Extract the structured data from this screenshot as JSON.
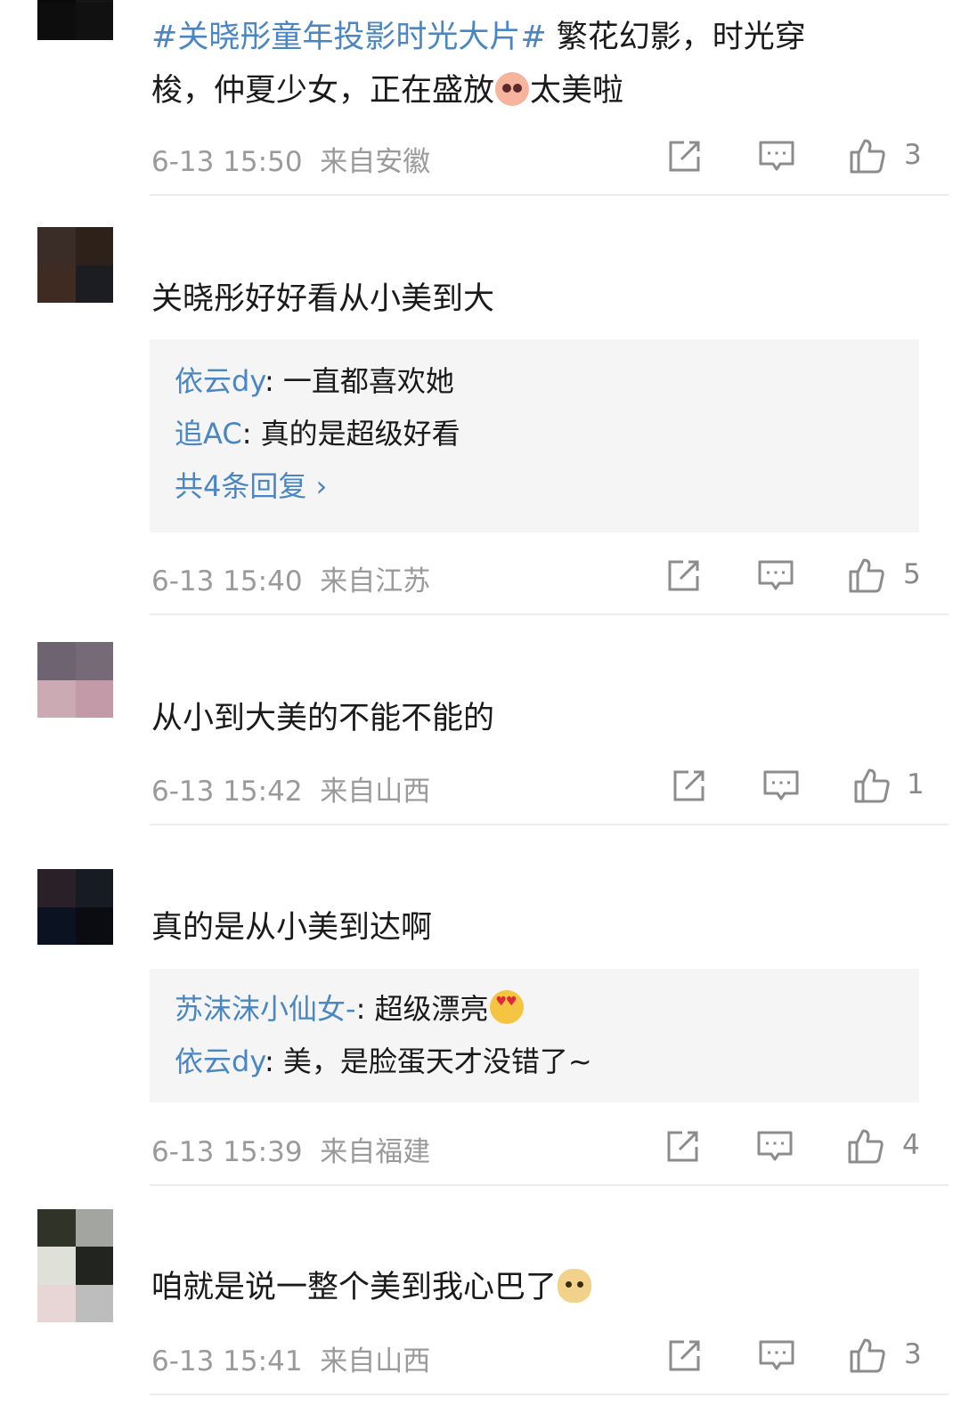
{
  "comments": [
    {
      "avatar": [
        "#0a0a0a",
        "#151515",
        "#0d0d0d",
        "#111111"
      ],
      "topic": "#关晓彤童年投影时光大片#",
      "text_line1": " 繁花幻影，时光穿",
      "text_line2": "梭，仲夏少女，正在盛放",
      "text_after_emoji": "太美啦",
      "time": "6-13 15:50",
      "location": "来自安徽",
      "likes": "3"
    },
    {
      "avatar": [
        "#3a2d28",
        "#2d2119",
        "#3e2c22",
        "#1b1d22"
      ],
      "text": "关晓彤好好看从小美到大",
      "replies": [
        {
          "user": "依云dy",
          "text": ": 一直都喜欢她"
        },
        {
          "user": "追AC",
          "text": ": 真的是超级好看"
        }
      ],
      "more_replies": "共4条回复 ›",
      "time": "6-13 15:40",
      "location": "来自江苏",
      "likes": "5"
    },
    {
      "avatar": [
        "#6e6370",
        "#766a78",
        "#ccaab3",
        "#c39aa8"
      ],
      "text": "从小到大美的不能不能的",
      "time": "6-13 15:42",
      "location": "来自山西",
      "likes": "1"
    },
    {
      "avatar": [
        "#2a2028",
        "#171b24",
        "#0b1322",
        "#0a0c12"
      ],
      "text": "真的是从小美到达啊",
      "replies": [
        {
          "user": "苏沫沫小仙女-",
          "text": ": 超级漂亮"
        },
        {
          "user": "依云dy",
          "text": ": 美，是脸蛋天才没错了~"
        }
      ],
      "time": "6-13 15:39",
      "location": "来自福建",
      "likes": "4"
    },
    {
      "avatar": [
        "#2f3328",
        "#a3a6a0",
        "#dfe1d9",
        "#222420"
      ],
      "text": "咱就是说一整个美到我心巴了",
      "time": "6-13 15:41",
      "location": "来自山西",
      "likes": "3"
    }
  ],
  "icons": {
    "share": "share-icon",
    "comment": "comment-icon",
    "like": "thumbs-up-icon"
  }
}
